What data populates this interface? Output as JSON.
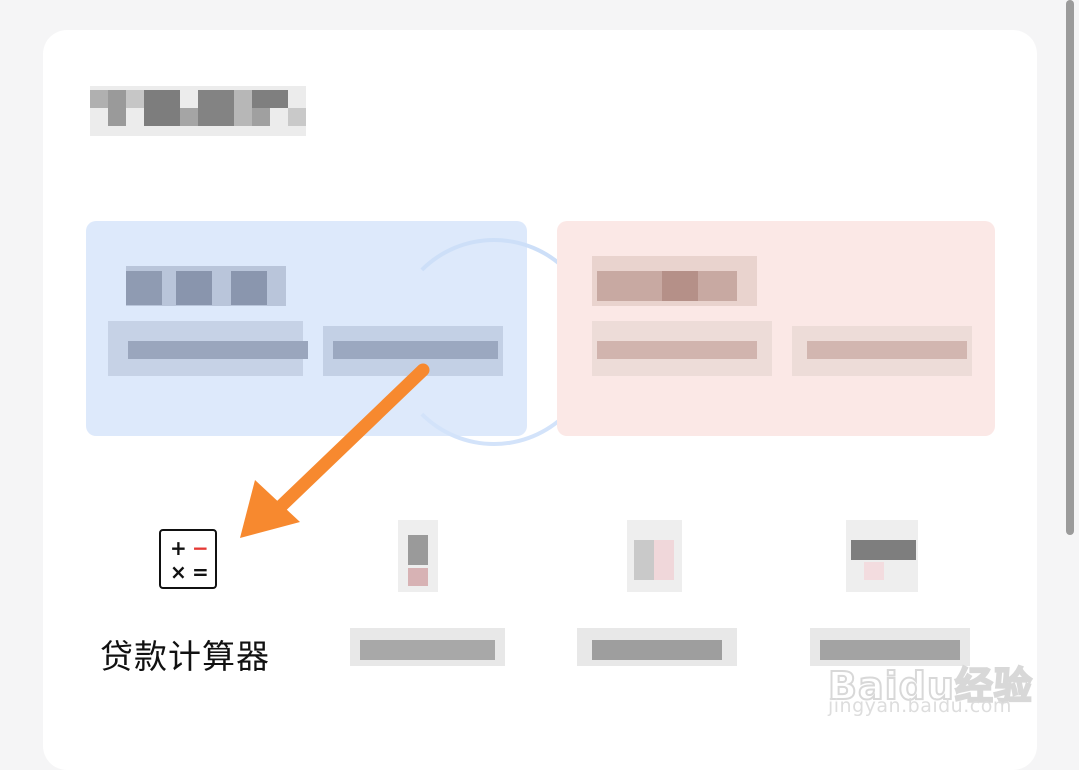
{
  "tools": {
    "loan_calculator_label": "贷款计算器",
    "calc_symbols": [
      "+",
      "−",
      "×",
      "="
    ]
  },
  "watermark": {
    "logo": "Baidu经验",
    "url": "jingyan.baidu.com"
  },
  "colors": {
    "arrow": "#f7892f",
    "blue_panel": "#dde9fb",
    "pink_panel": "#fbe8e6",
    "minus_red": "#e53935"
  }
}
